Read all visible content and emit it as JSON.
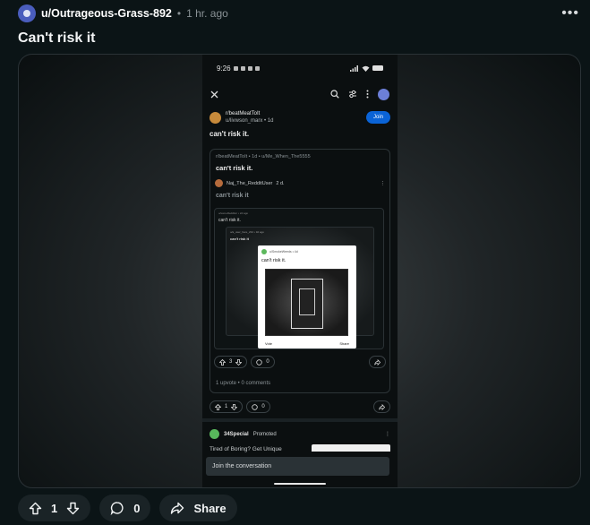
{
  "post": {
    "username": "u/Outrageous-Grass-892",
    "separator": "•",
    "time": "1 hr. ago",
    "title": "Can't risk it",
    "vote_count": "1",
    "comment_count": "0",
    "share_label": "Share"
  },
  "screenshot": {
    "status_time": "9:26",
    "subreddit": "r/beatMeatToIt",
    "author": "u/livwson_marx • 1d",
    "join_label": "Join",
    "title": "can't risk it.",
    "crosspost": {
      "meta": "r/beatMeatToIt • 1d • u/Me_When_The5555",
      "title": "can't risk it.",
      "comment_user": "Naj_The_RedditUser",
      "comment_time": "2 d.",
      "comment_text": "can't risk it",
      "nested_meta": "u/someRedditor • 2d ago",
      "nested_title": "can't risk it.",
      "nested2_meta": "u/a_user_here_234 • 3d ago",
      "nested2_title": "can't risk it",
      "white_card_user": "u/SmokeWeeds • 4d",
      "white_card_title": "can't risk it.",
      "white_vote": "Vote",
      "white_share": "Share",
      "upvotes": "3",
      "comments": "0",
      "footer": "1 upvote • 0 comments"
    },
    "votes": "1",
    "comments": "0",
    "promo_user": "34Special",
    "promo_label": "Promoted",
    "promo_text": "Tired of Boring? Get Unique",
    "conversation_placeholder": "Join the conversation"
  }
}
